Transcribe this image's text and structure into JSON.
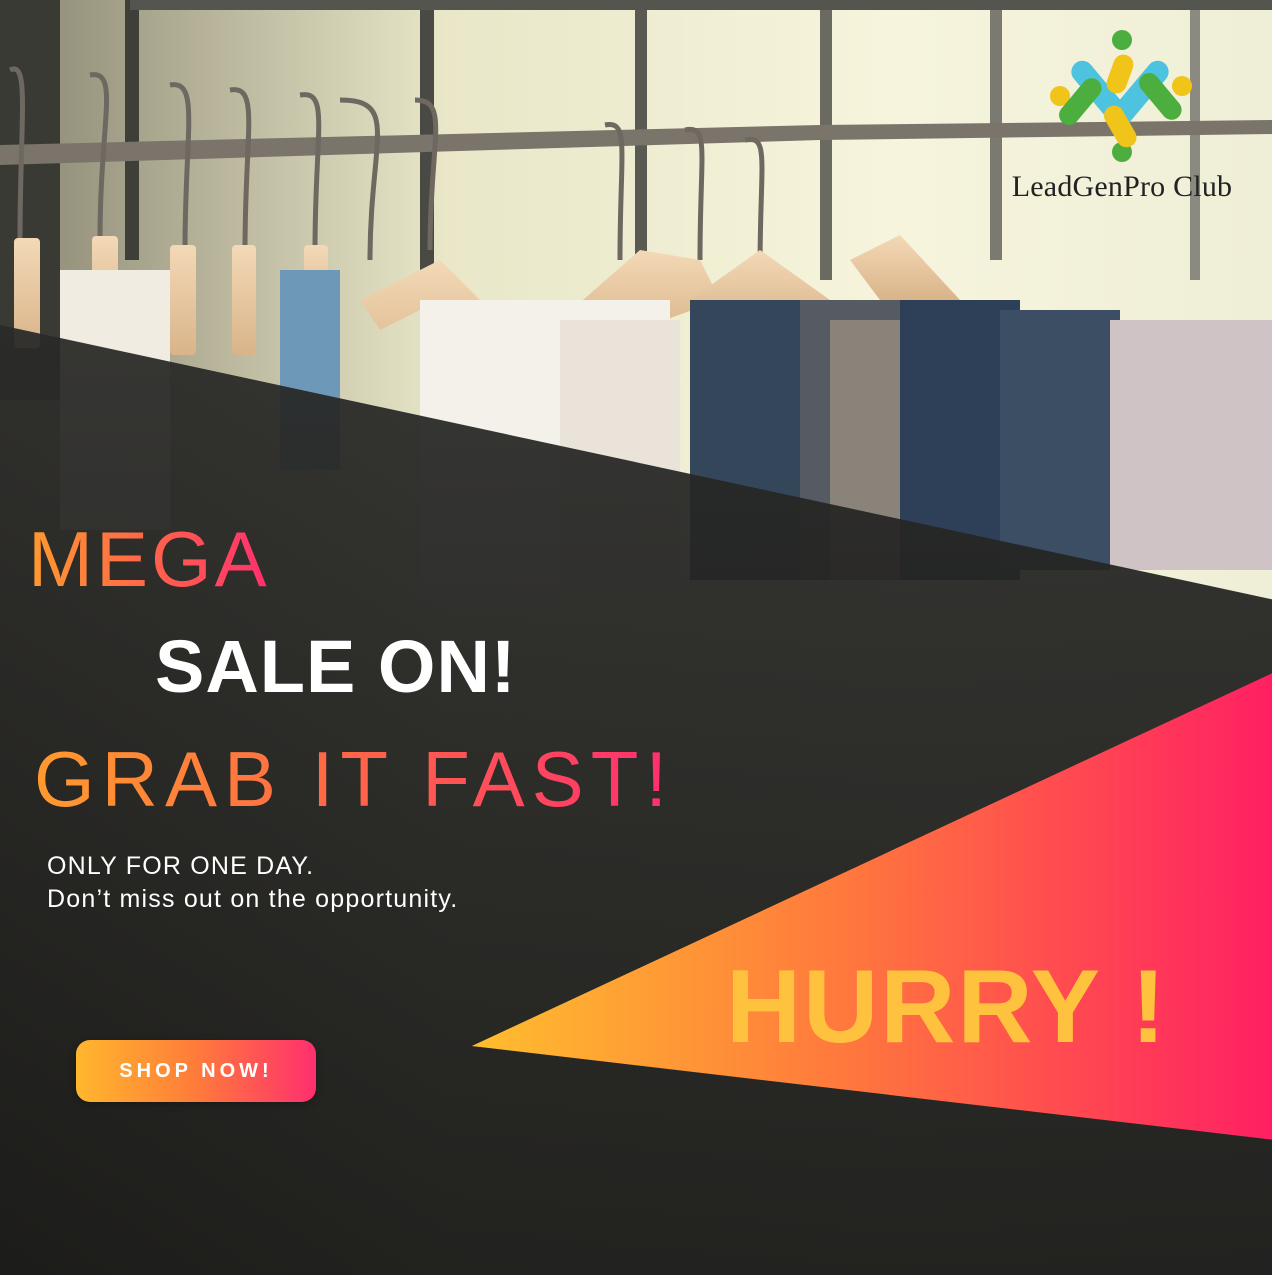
{
  "brand": {
    "name": "LeadGenPro Club",
    "logo_icon": "people-circle-logo",
    "logo_colors": [
      "#4ec3e0",
      "#f0c419",
      "#4cae3f"
    ]
  },
  "headline": {
    "line1": "MEGA",
    "line2": "SALE ON!",
    "line3": "GRAB IT FAST!"
  },
  "subtext": {
    "line1": "ONLY FOR ONE DAY.",
    "line2": "Don’t miss out on the opportunity."
  },
  "cta": {
    "label": "SHOP NOW!"
  },
  "callout": {
    "text": "HURRY !"
  },
  "colors": {
    "accent_orange": "#ff9a2e",
    "accent_pink": "#ff2f6f",
    "accent_yellow": "#ffc23e",
    "dark_panel": "#1c1c1c"
  },
  "background": {
    "image": "clothing-rack-photo"
  }
}
